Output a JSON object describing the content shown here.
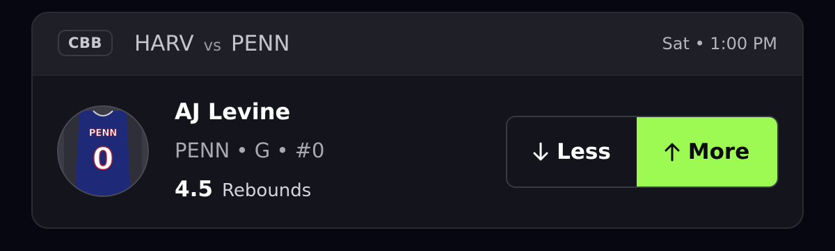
{
  "header": {
    "league": "CBB",
    "away_team": "HARV",
    "vs": "vs",
    "home_team": "PENN",
    "time": "Sat • 1:00 PM"
  },
  "player": {
    "jersey_text": "PENN",
    "jersey_number": "0",
    "name": "AJ Levine",
    "meta": "PENN • G • #0",
    "line": "4.5",
    "stat": "Rebounds"
  },
  "buttons": {
    "less_label": "Less",
    "less_icon": "arrow-down-icon",
    "more_label": "More",
    "more_icon": "arrow-up-icon"
  },
  "colors": {
    "background": "#070711",
    "card": "#14141d",
    "header": "#1f1f28",
    "more_accent": "#9dfa52",
    "jersey": "#1e2a78"
  }
}
